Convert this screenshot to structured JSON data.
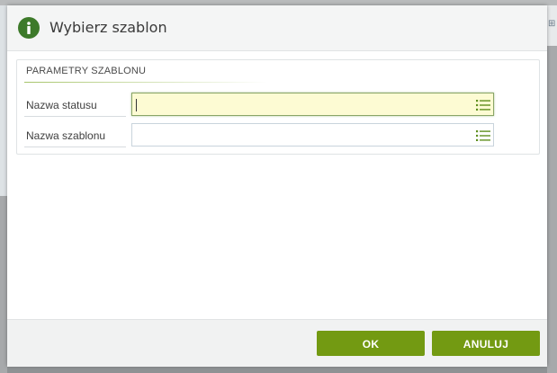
{
  "dialog": {
    "title": "Wybierz szablon",
    "header_icon": "info-icon",
    "section": {
      "legend": "PARAMETRY SZABLONU",
      "fields": [
        {
          "label": "Nazwa statusu",
          "value": "",
          "icon": "list-icon",
          "focused": true
        },
        {
          "label": "Nazwa szablonu",
          "value": "",
          "icon": "list-icon",
          "focused": false
        }
      ]
    },
    "buttons": {
      "ok_label": "OK",
      "cancel_label": "ANULUJ"
    }
  },
  "colors": {
    "accent_green": "#739a12",
    "icon_green": "#3d7a2a",
    "focused_input_bg": "#fdfbd3"
  }
}
